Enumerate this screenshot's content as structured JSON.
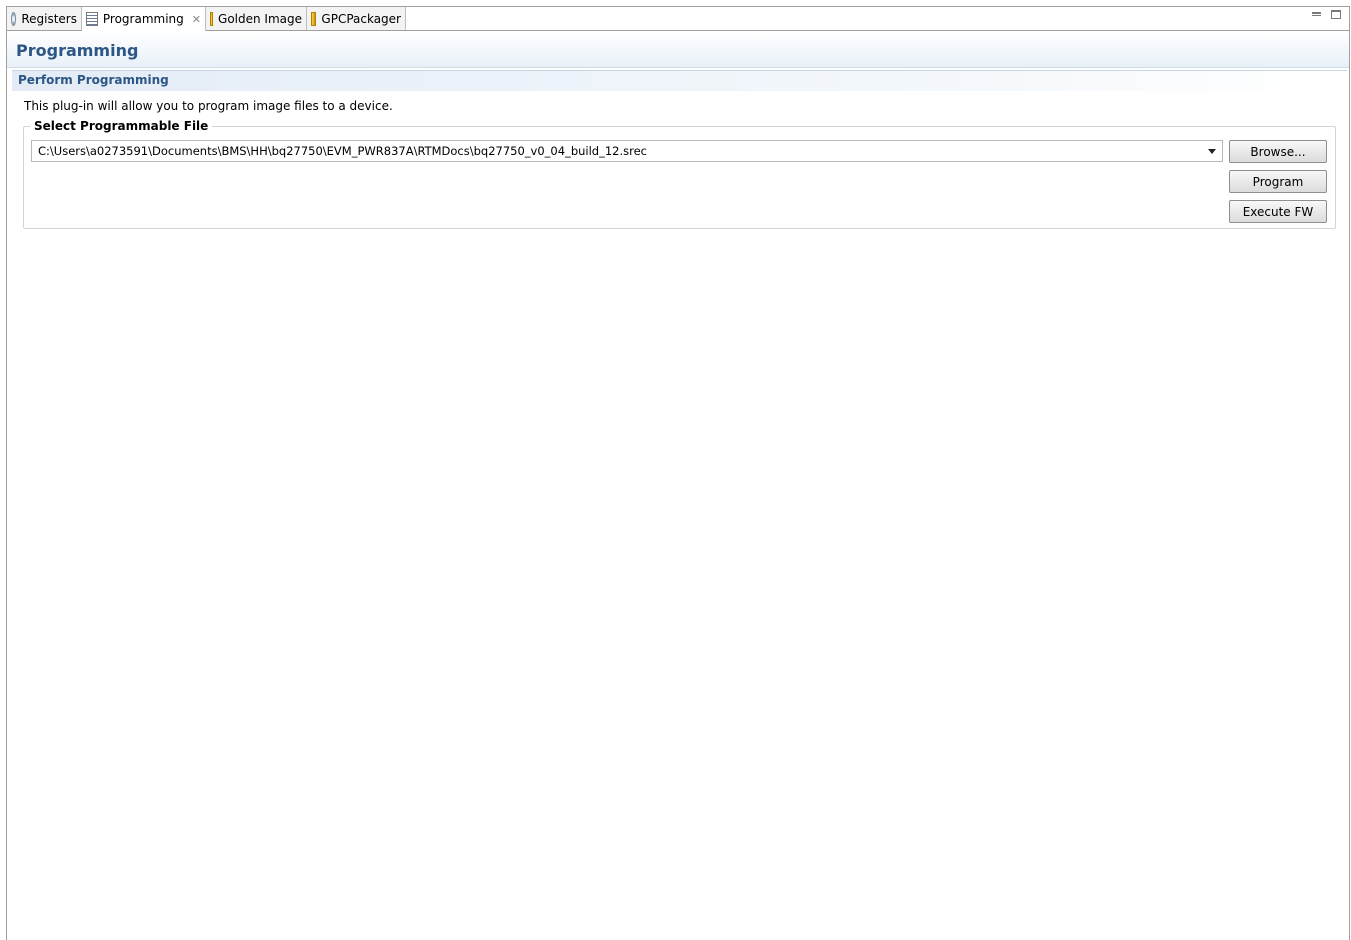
{
  "tabs": [
    {
      "label": "Registers",
      "icon": "registers-icon"
    },
    {
      "label": "Programming",
      "icon": "programming-icon",
      "active": true,
      "close": "✕"
    },
    {
      "label": "Golden Image",
      "icon": "golden-image-icon"
    },
    {
      "label": "GPCPackager",
      "icon": "gpc-packager-icon"
    }
  ],
  "header": {
    "title": "Programming"
  },
  "section": {
    "title": "Perform Programming"
  },
  "description": "This plug-in will allow you to program image files to a device.",
  "file_group": {
    "title": "Select Programmable File",
    "selected_file": "C:\\Users\\a0273591\\Documents\\BMS\\HH\\bq27750\\EVM_PWR837A\\RTMDocs\\bq27750_v0_04_build_12.srec"
  },
  "buttons": {
    "browse": "Browse...",
    "program": "Program",
    "execute": "Execute FW"
  },
  "colors": {
    "title": "#2c5685"
  }
}
